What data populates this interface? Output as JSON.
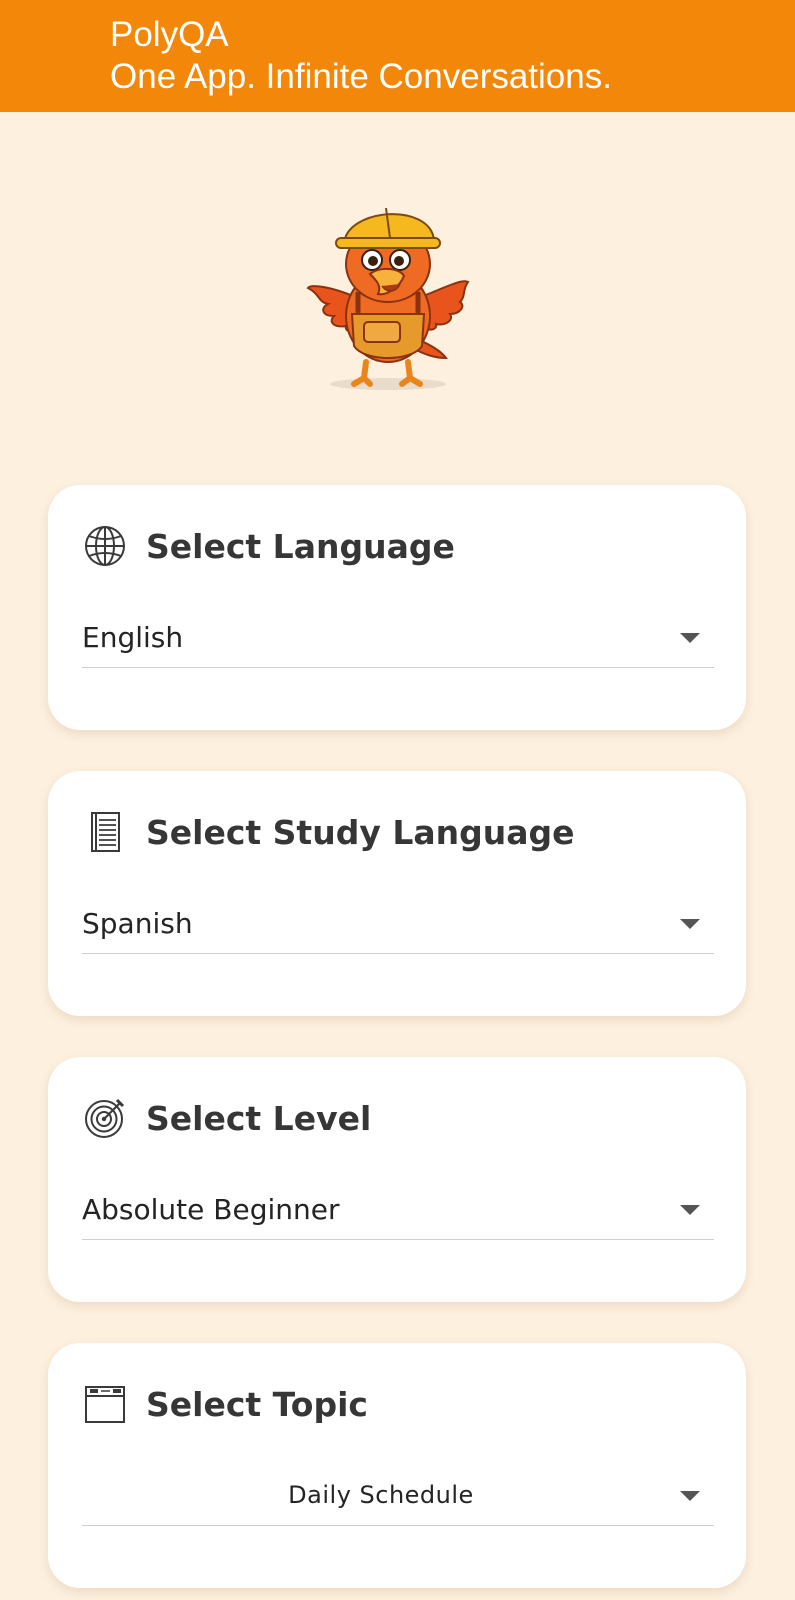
{
  "app_bar": {
    "title": "PolyQA",
    "subtitle": "One App. Infinite Conversations."
  },
  "mascot": {
    "icon": "parrot-mascot-icon"
  },
  "cards": [
    {
      "icon": "globe-icon",
      "title": "Select Language",
      "value": "English"
    },
    {
      "icon": "notebook-icon",
      "title": "Select Study Language",
      "value": "Spanish"
    },
    {
      "icon": "target-icon",
      "title": "Select Level",
      "value": "Absolute Beginner"
    },
    {
      "icon": "calendar-icon",
      "title": "Select Topic",
      "value": "Daily Schedule"
    }
  ],
  "colors": {
    "app_bar": "#f2870a",
    "background": "#fdf0df",
    "card": "#ffffff"
  }
}
